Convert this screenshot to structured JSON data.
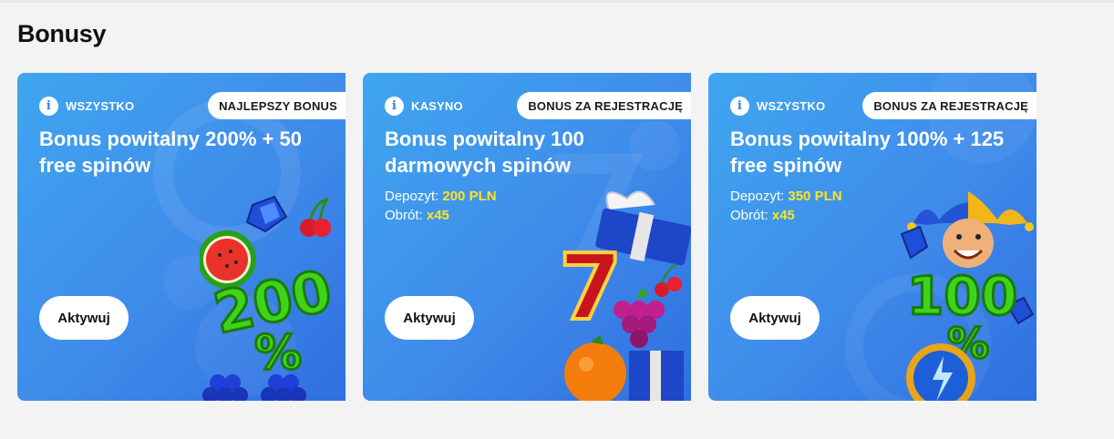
{
  "section": {
    "title": "Bonusy"
  },
  "cards": [
    {
      "category": "WSZYSTKO",
      "badge": "NAJLEPSZY BONUS",
      "title": "Bonus powitalny 200% + 50 free spinów",
      "button": "Aktywuj",
      "art_text": "200",
      "art_icons": [
        "watermelon-icon",
        "cherries-icon",
        "diamond-icon",
        "grapes-icon"
      ]
    },
    {
      "category": "KASYNO",
      "badge": "BONUS ZA REJESTRACJĘ",
      "title": "Bonus powitalny 100 darmowych spinów",
      "deposit_label": "Depozyt: ",
      "deposit_value": "200 PLN",
      "wager_label": "Obrót: ",
      "wager_value": "x45",
      "button": "Aktywuj",
      "art_text": "7",
      "art_icons": [
        "gift-box-icon",
        "grapes-icon",
        "orange-icon",
        "cherries-icon"
      ]
    },
    {
      "category": "WSZYSTKO",
      "badge": "BONUS ZA REJESTRACJĘ",
      "title": "Bonus powitalny 100% + 125 free spinów",
      "deposit_label": "Depozyt: ",
      "deposit_value": "350 PLN",
      "wager_label": "Obrót: ",
      "wager_value": "x45",
      "button": "Aktywuj",
      "art_text": "100",
      "art_icons": [
        "jester-icon",
        "diamond-icon",
        "coin-icon"
      ]
    }
  ],
  "colors": {
    "card_gradient": [
      "#3fa6f0",
      "#2f6fe0"
    ],
    "highlight": "#ffe51c",
    "green_number": "#3fd41a"
  }
}
